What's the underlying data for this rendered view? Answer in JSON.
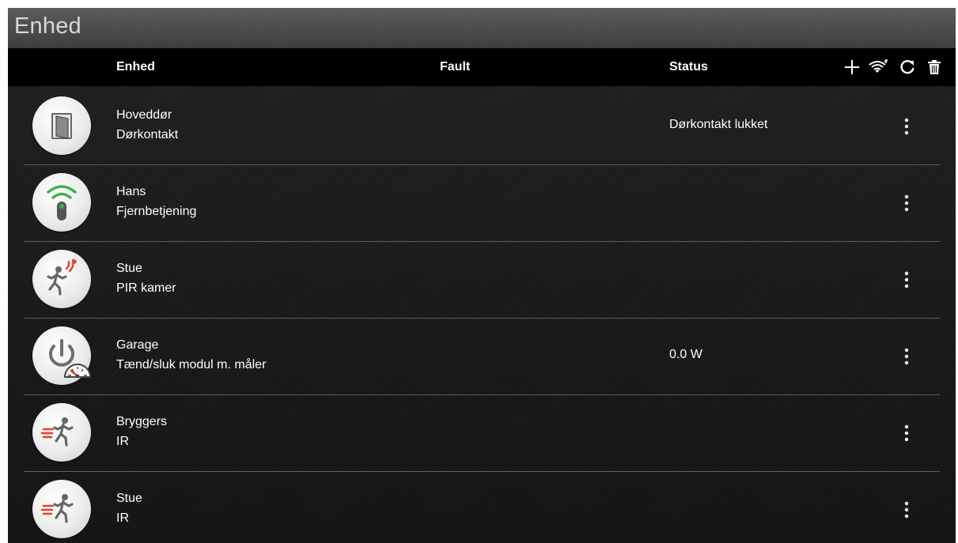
{
  "title": "Enhed",
  "header": {
    "device": "Enhed",
    "fault": "Fault",
    "status": "Status"
  },
  "toolbar": [
    "add-icon",
    "wifi-icon",
    "refresh-icon",
    "trash-icon"
  ],
  "devices": [
    {
      "name": "Hoveddør",
      "type": "Dørkontakt",
      "fault": "",
      "status": "Dørkontakt lukket",
      "icon": "door-contact-icon"
    },
    {
      "name": "Hans",
      "type": "Fjernbetjening",
      "fault": "",
      "status": "",
      "icon": "remote-control-icon"
    },
    {
      "name": "Stue",
      "type": "PIR kamer",
      "fault": "",
      "status": "",
      "icon": "pir-camera-icon"
    },
    {
      "name": "Garage",
      "type": "Tænd/sluk modul m. måler",
      "fault": "",
      "status": "0.0 W",
      "icon": "power-meter-icon"
    },
    {
      "name": "Bryggers",
      "type": "IR",
      "fault": "",
      "status": "",
      "icon": "ir-motion-icon"
    },
    {
      "name": "Stue",
      "type": "IR",
      "fault": "",
      "status": "",
      "icon": "ir-motion-icon"
    }
  ],
  "colors": {
    "accent_green": "#3fb24a",
    "accent_red": "#e0452a"
  }
}
